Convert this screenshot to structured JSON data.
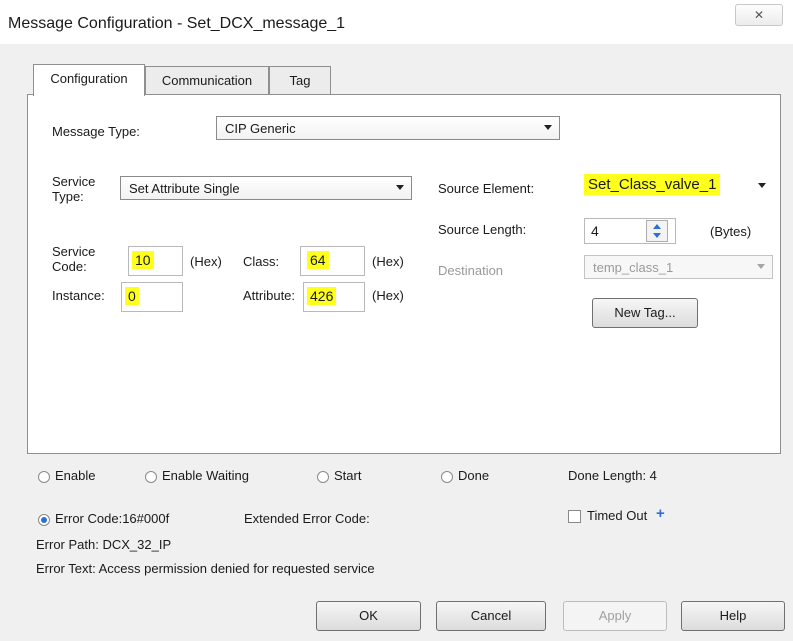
{
  "window": {
    "title": "Message Configuration - Set_DCX_message_1",
    "close_glyph": "✕"
  },
  "tabs": [
    {
      "label": "Configuration",
      "active": true
    },
    {
      "label": "Communication",
      "active": false
    },
    {
      "label": "Tag",
      "active": false
    }
  ],
  "config": {
    "message_type_label": "Message Type:",
    "message_type_value": "CIP Generic",
    "service_type_label_1": "Service",
    "service_type_label_2": "Type:",
    "service_type_value": "Set Attribute Single",
    "service_code_label_1": "Service",
    "service_code_label_2": "Code:",
    "service_code_value": "10",
    "service_code_unit": "(Hex)",
    "class_label": "Class:",
    "class_value": "64",
    "class_unit": "(Hex)",
    "instance_label": "Instance:",
    "instance_value": "0",
    "attribute_label": "Attribute:",
    "attribute_value": "426",
    "attribute_unit": "(Hex)",
    "source_element_label": "Source Element:",
    "source_element_value": "Set_Class_valve_1",
    "source_length_label": "Source Length:",
    "source_length_value": "4",
    "source_length_unit": "(Bytes)",
    "destination_label": "Destination",
    "destination_value": "temp_class_1",
    "new_tag_label": "New Tag..."
  },
  "status": {
    "enable": "Enable",
    "enable_waiting": "Enable Waiting",
    "start": "Start",
    "done": "Done",
    "done_length": "Done Length: 4",
    "error_code": "Error Code:16#000f",
    "extended_error": "Extended Error Code:",
    "timed_out": "Timed Out",
    "timed_out_marker": "+",
    "error_path": "Error Path:  DCX_32_IP",
    "error_text": "Error Text:  Access permission denied for requested service"
  },
  "buttons": {
    "ok": "OK",
    "cancel": "Cancel",
    "apply": "Apply",
    "help": "Help"
  },
  "colors": {
    "highlight": "#ffff1e",
    "radio_checked": "#2c6fd6"
  }
}
